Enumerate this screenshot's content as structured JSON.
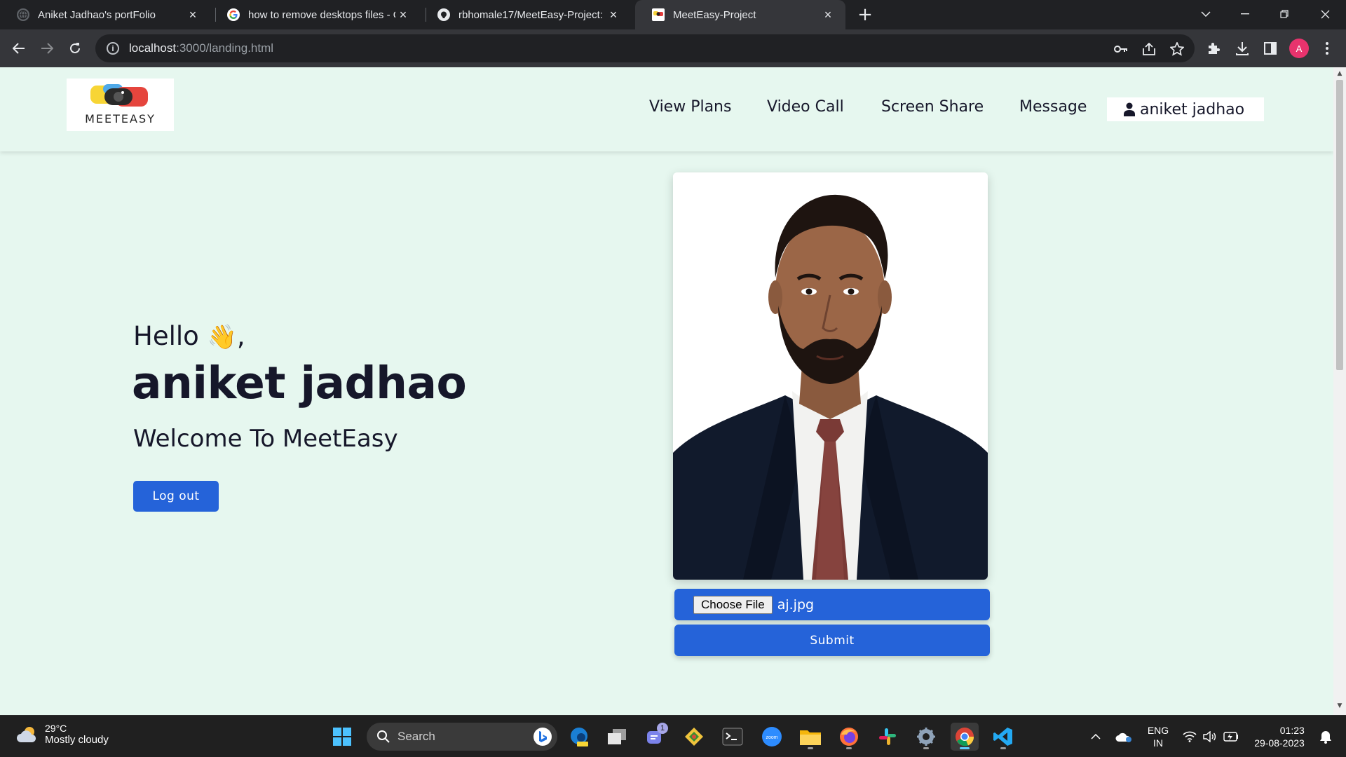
{
  "browser": {
    "tabs": [
      {
        "title": "Aniket Jadhao's portFolio",
        "active": false
      },
      {
        "title": "how to remove desktops files - G",
        "active": false
      },
      {
        "title": "rbhomale17/MeetEasy-Project: In",
        "active": false
      },
      {
        "title": "MeetEasy-Project",
        "active": true
      }
    ],
    "new_tab_label": "+",
    "url_host": "localhost",
    "url_path": ":3000/landing.html",
    "profile_initial": "A"
  },
  "site": {
    "logo_text": "MEETEASY",
    "nav": [
      "View Plans",
      "Video Call",
      "Screen Share",
      "Message"
    ],
    "user_name": "aniket jadhao",
    "accent_color": "#2563d9",
    "background_color": "#e6f7ef"
  },
  "hero": {
    "greeting": "Hello",
    "greeting_emoji": "👋",
    "greeting_suffix": ",",
    "name": "aniket jadhao",
    "welcome": "Welcome To MeetEasy",
    "logout_label": "Log out"
  },
  "upload": {
    "choose_label": "Choose File",
    "file_name": "aj.jpg",
    "submit_label": "Submit"
  },
  "taskbar": {
    "weather_temp": "29°C",
    "weather_desc": "Mostly cloudy",
    "search_placeholder": "Search",
    "teams_badge": "1",
    "lang_line1": "ENG",
    "lang_line2": "IN",
    "time": "01:23",
    "date": "29-08-2023"
  }
}
